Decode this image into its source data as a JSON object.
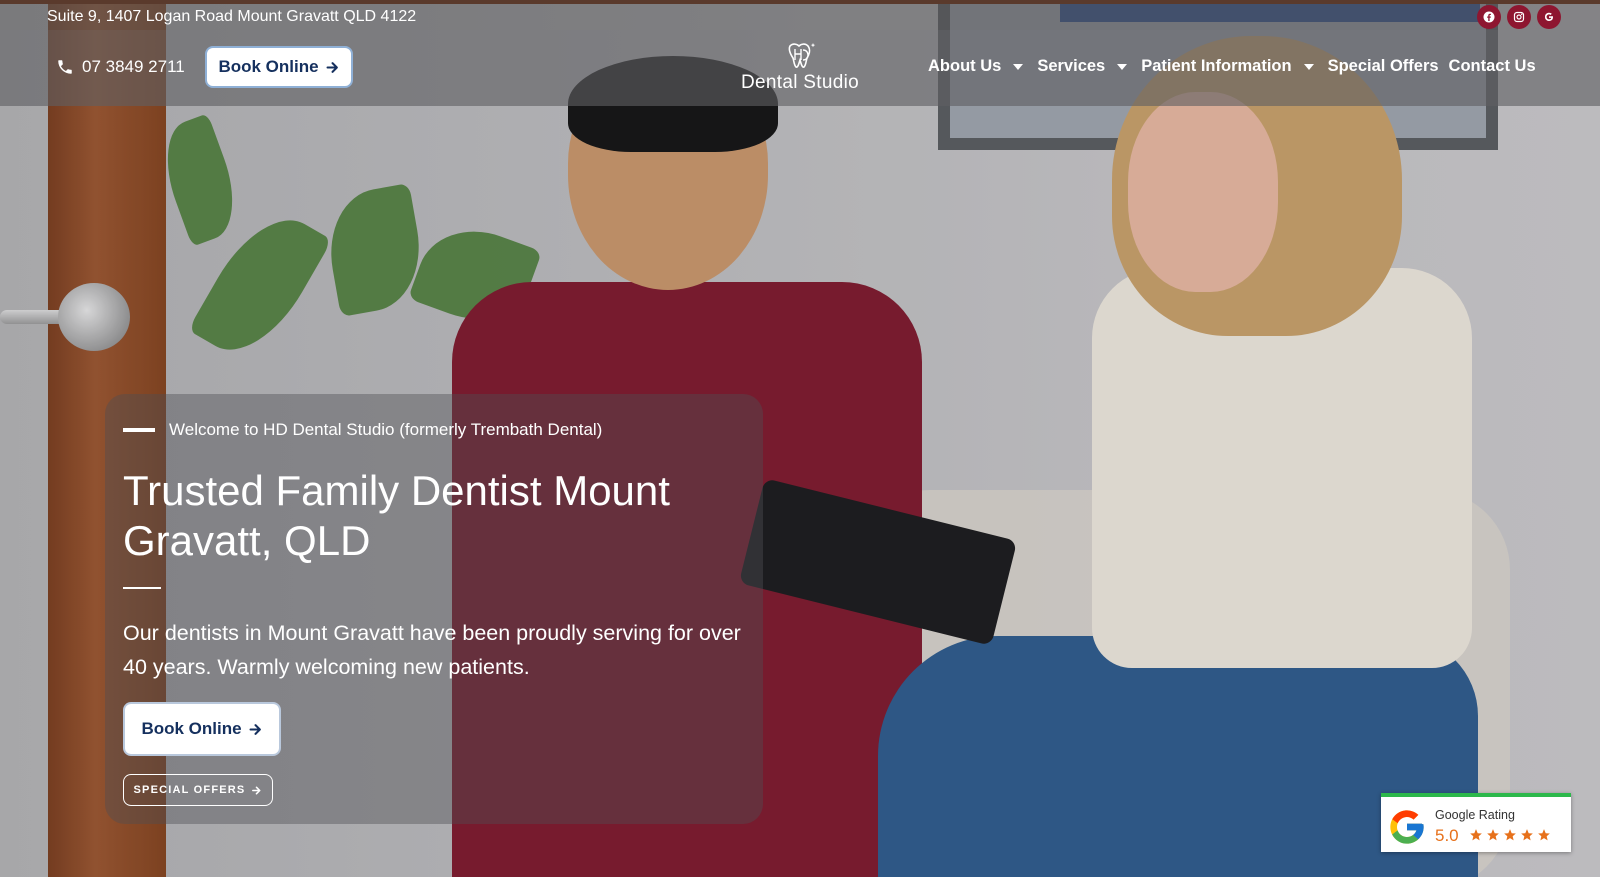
{
  "topbar": {
    "address": "Suite 9, 1407 Logan Road Mount Gravatt QLD 4122",
    "socials": [
      {
        "icon": "facebook-icon"
      },
      {
        "icon": "instagram-icon"
      },
      {
        "icon": "google-icon"
      }
    ]
  },
  "header": {
    "phone": "07 3849 2711",
    "book_label": "Book Online",
    "logo_text": "Dental Studio",
    "nav": [
      {
        "label": "About Us",
        "has_dropdown": true
      },
      {
        "label": "Services",
        "has_dropdown": true
      },
      {
        "label": "Patient Information",
        "has_dropdown": true
      },
      {
        "label": "Special Offers",
        "has_dropdown": false
      },
      {
        "label": "Contact Us",
        "has_dropdown": false
      }
    ]
  },
  "hero": {
    "eyebrow": "Welcome to HD Dental Studio (formerly Trembath Dental)",
    "title": "Trusted Family Dentist Mount Gravatt, QLD",
    "text": "Our dentists in Mount Gravatt have been proudly serving for over 40 years. Warmly welcoming new patients.",
    "book_label": "Book Online",
    "special_label": "SPECIAL OFFERS"
  },
  "rating": {
    "title": "Google Rating",
    "score": "5.0",
    "stars": 5
  },
  "colors": {
    "brand_navy": "#15305e",
    "social_red": "#8e1630",
    "star_orange": "#e7711b",
    "rating_green": "#2cb84b"
  }
}
